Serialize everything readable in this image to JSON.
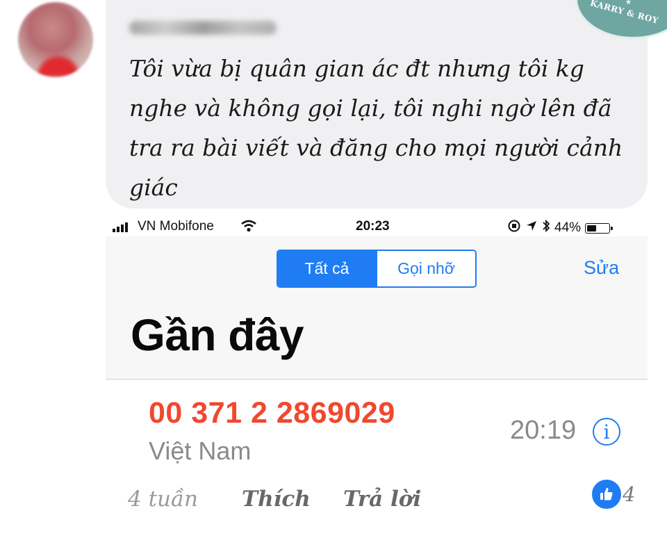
{
  "comment": {
    "text": "Tôi vừa bị quân gian ác đt nhưng tôi kg nghe và không gọi lại, tôi nghi ngờ lên đã tra ra bài viết và đăng cho mọi người cảnh giác",
    "actions": {
      "age": "4 tuần",
      "like": "Thích",
      "reply": "Trả lời"
    },
    "reaction_count": "4"
  },
  "watermark": {
    "text": "KARRY & ROY"
  },
  "phone": {
    "status_bar": {
      "carrier": "VN Mobifone",
      "time": "20:23",
      "battery": "44%",
      "battery_level": 0.44
    },
    "segments": {
      "all": "Tất cả",
      "missed": "Gọi nhỡ"
    },
    "edit": "Sửa",
    "title": "Gần đây",
    "recent_call": {
      "number": "00 371 2 2869029",
      "location": "Việt Nam",
      "time": "20:19"
    }
  },
  "colors": {
    "ios_blue": "#1f7cf3",
    "missed_red": "#f0482f",
    "bubble_gray": "#f0f0f2"
  }
}
